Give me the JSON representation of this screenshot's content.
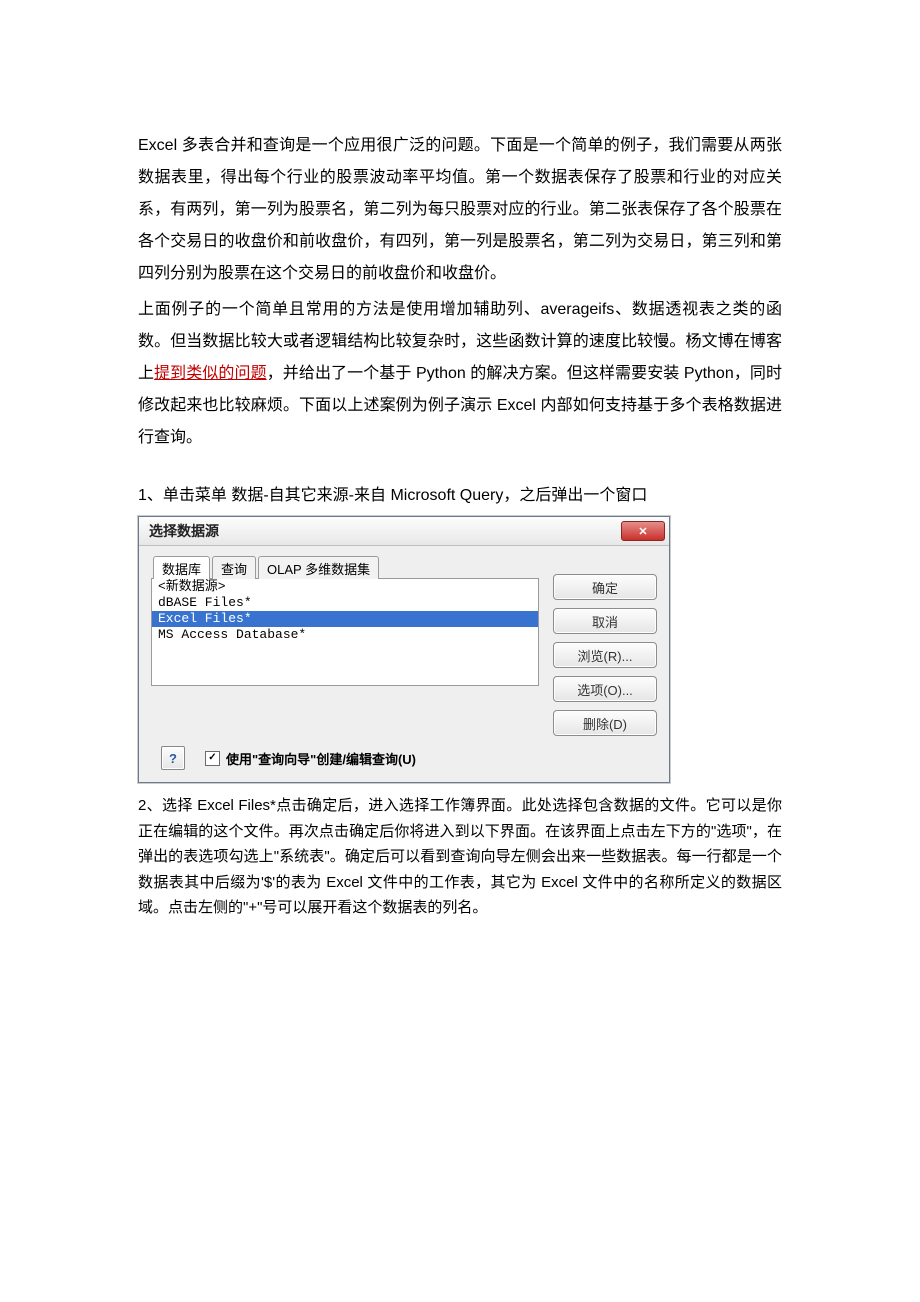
{
  "doc": {
    "para1_a": "Excel 多表合并和查询是一个应用很广泛的问题。下面是一个简单的例子，我们需要从两张数据表里，得出每个行业的股票波动率平均值。第一个数据表保存了股票和行业的对应关系，有两列，第一列为股票名，第二列为每只股票对应的行业。第二张表保存了各个股票在各个交易日的收盘价和前收盘价，有四列，第一列是股票名，第二列为交易日，第三列和第四列分别为股票在这个交易日的前收盘价和收盘价。",
    "para2_prelink": "上面例子的一个简单且常用的方法是使用增加辅助列、averageifs、数据透视表之类的函数。但当数据比较大或者逻辑结构比较复杂时，这些函数计算的速度比较慢。杨文博在博客上",
    "para2_link": "提到类似的问题",
    "para2_postlink": "，并给出了一个基于 Python 的解决方案。但这样需要安装 Python，同时修改起来也比较麻烦。下面以上述案例为例子演示 Excel 内部如何支持基于多个表格数据进行查询。",
    "step1": "1、单击菜单 数据-自其它来源-来自 Microsoft Query，之后弹出一个窗口",
    "step2": "2、选择 Excel Files*点击确定后，进入选择工作簿界面。此处选择包含数据的文件。它可以是你正在编辑的这个文件。再次点击确定后你将进入到以下界面。在该界面上点击左下方的\"选项\"，在弹出的表选项勾选上\"系统表\"。确定后可以看到查询向导左侧会出来一些数据表。每一行都是一个数据表其中后缀为'$'的表为 Excel 文件中的工作表，其它为 Excel 文件中的名称所定义的数据区域。点击左侧的\"+\"号可以展开看这个数据表的列名。"
  },
  "dialog": {
    "title": "选择数据源",
    "tabs": {
      "db": "数据库",
      "query": "查询",
      "olap": "OLAP 多维数据集"
    },
    "list": {
      "item0": "<新数据源>",
      "item1": "dBASE Files*",
      "item2": "Excel Files*",
      "item3": "MS Access Database*"
    },
    "buttons": {
      "ok": "确定",
      "cancel": "取消",
      "browse": "浏览(R)...",
      "options": "选项(O)...",
      "delete": "删除(D)"
    },
    "footer": {
      "checked_glyph": "✓",
      "checkbox_label": "使用\"查询向导\"创建/编辑查询(U)",
      "help_glyph": "?"
    }
  }
}
